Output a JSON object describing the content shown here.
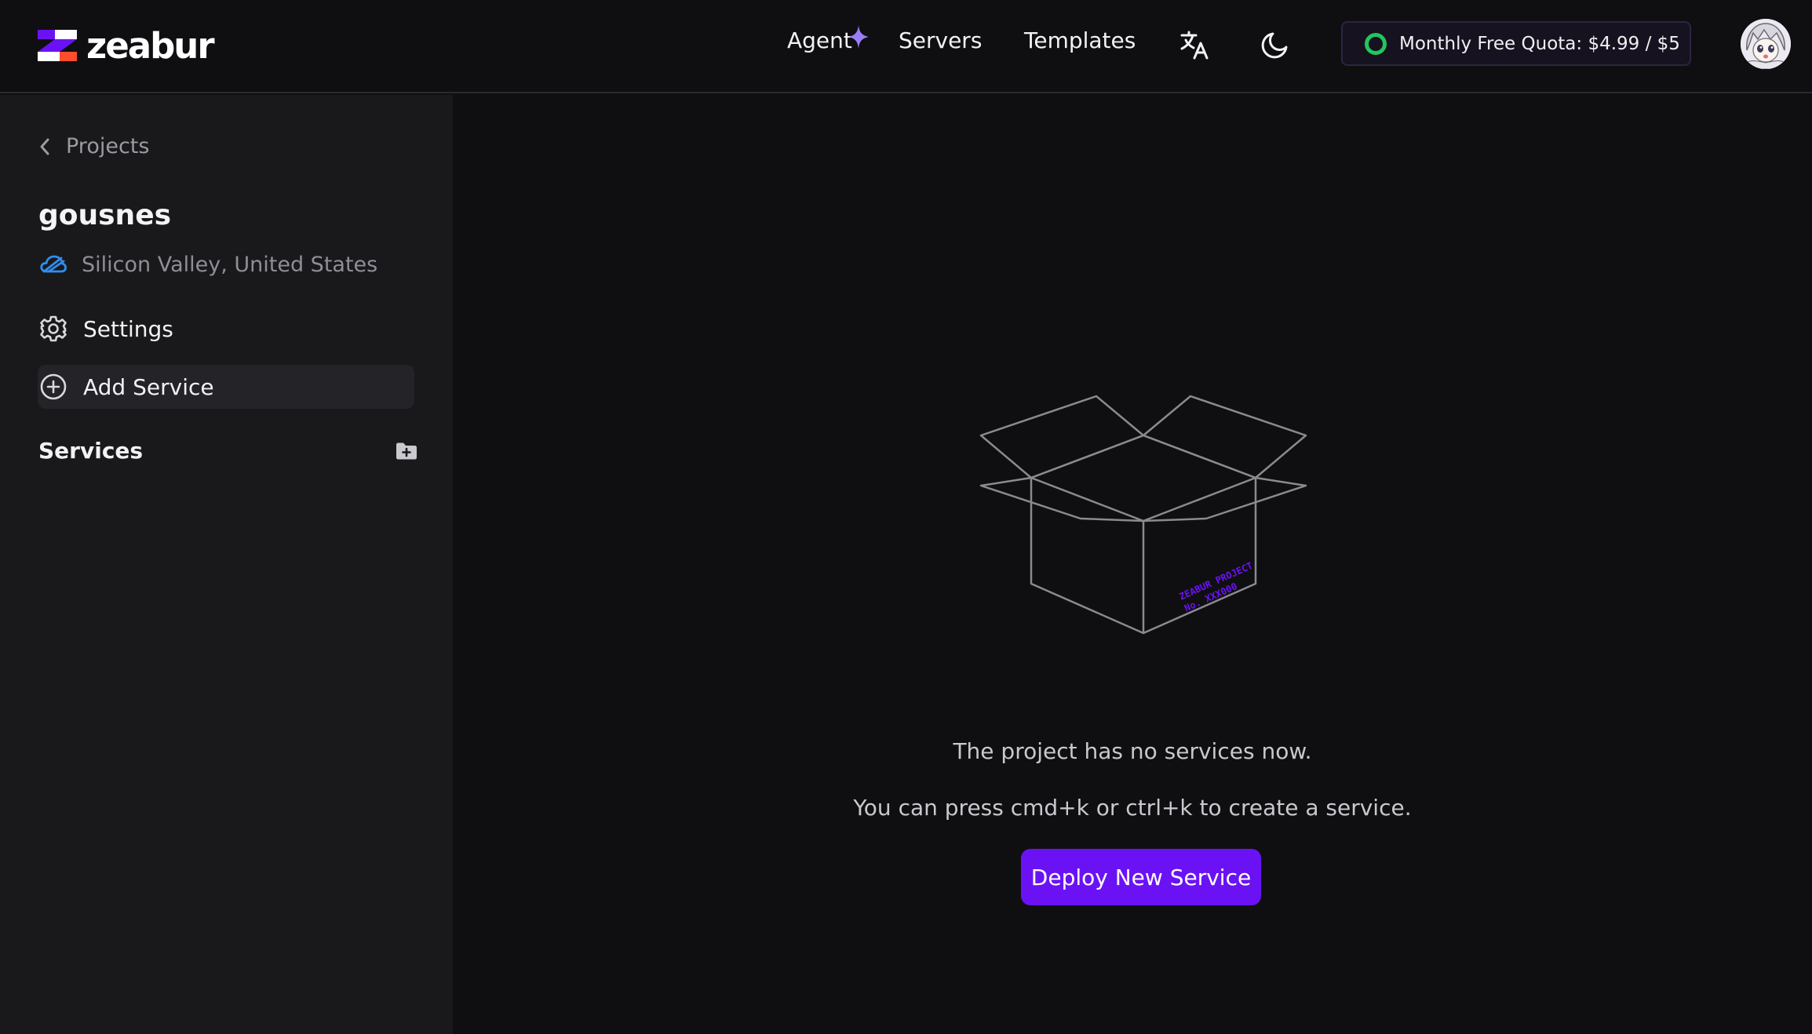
{
  "brand": {
    "name": "zeabur",
    "accent": "#6b12f5",
    "logo_colors": [
      "#6b12f5",
      "#ffffff",
      "#ff4d2e"
    ]
  },
  "nav": {
    "items": [
      {
        "label": "Agent",
        "icon": "sparkle-icon"
      },
      {
        "label": "Servers"
      },
      {
        "label": "Templates"
      }
    ],
    "translate_icon": "translate-icon",
    "theme_icon": "moon-icon"
  },
  "quota": {
    "label": "Monthly Free Quota: $4.99 / $5",
    "status_color": "#22c55e"
  },
  "sidebar": {
    "back_label": "Projects",
    "project_name": "gousnes",
    "region": "Silicon Valley, United States",
    "items": [
      {
        "label": "Settings",
        "icon": "gear-icon"
      },
      {
        "label": "Add Service",
        "icon": "plus-circle-icon"
      }
    ],
    "services_heading": "Services"
  },
  "main": {
    "box_stamp_line1": "ZEABUR PROJECT",
    "box_stamp_line2": "No. XXX000",
    "empty_message": "The project has no services now.",
    "hint_message": "You can press cmd+k or ctrl+k to create a service.",
    "deploy_button": "Deploy New Service"
  }
}
